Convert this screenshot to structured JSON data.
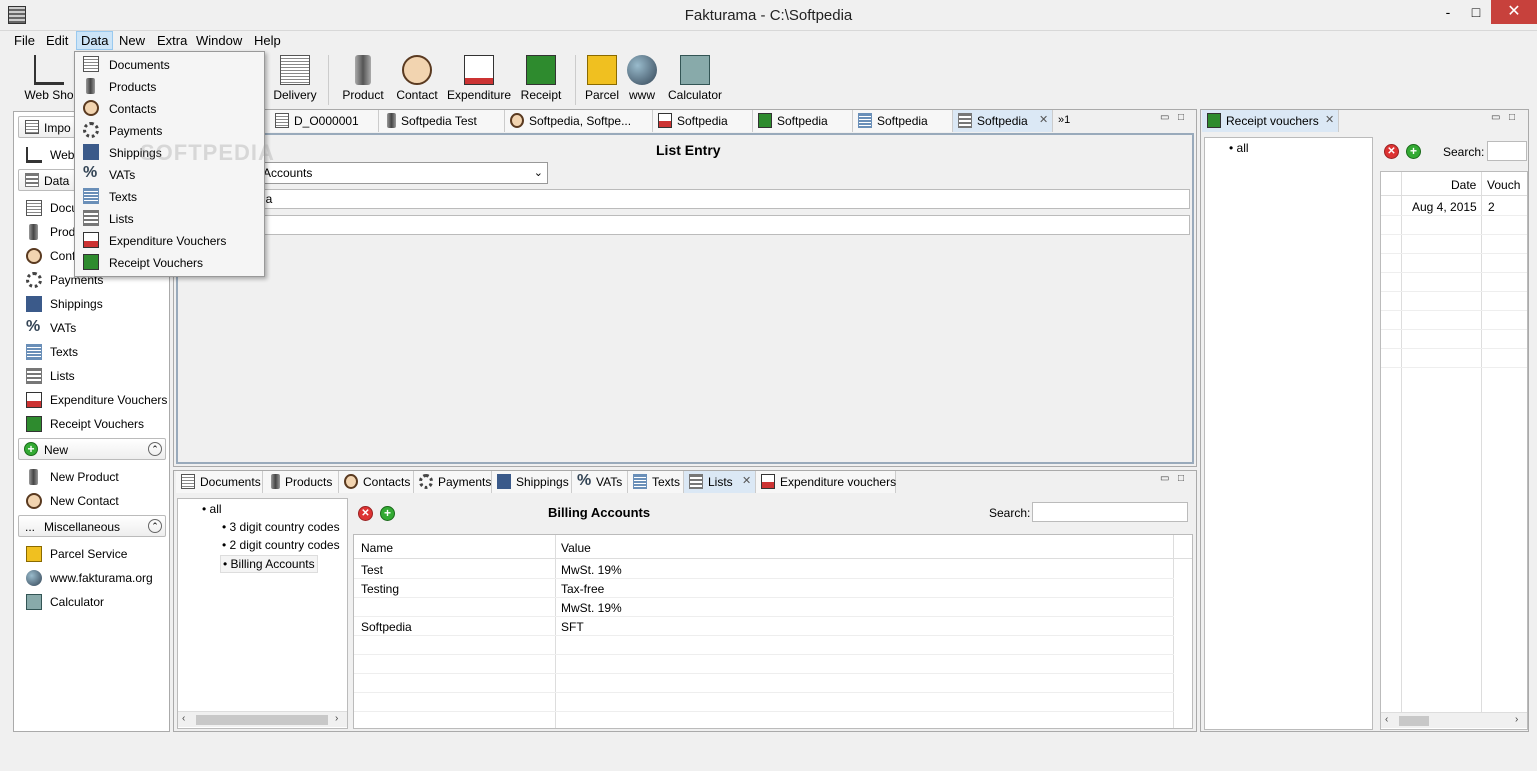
{
  "window": {
    "title": "Fakturama - C:\\Softpedia",
    "minimize": "-",
    "maximize": "□",
    "close": "✕"
  },
  "menubar": {
    "items": [
      "File",
      "Edit",
      "Data",
      "New",
      "Extra",
      "Window",
      "Help"
    ]
  },
  "toolbar": {
    "buttons": [
      "Web Sho",
      "Delivery",
      "Product",
      "Contact",
      "Expenditure",
      "Receipt",
      "Parcel",
      "www",
      "Calculator"
    ]
  },
  "data_menu": {
    "items": [
      "Documents",
      "Products",
      "Contacts",
      "Payments",
      "Shippings",
      "VATs",
      "Texts",
      "Lists",
      "Expenditure Vouchers",
      "Receipt Vouchers"
    ]
  },
  "watermark": "SOFTPEDIA",
  "sidebar": {
    "import_header": "Impo",
    "web_item": "Web",
    "data_header": "Data",
    "data_items": [
      "Docu",
      "Prod",
      "Conf",
      "Payments",
      "Shippings",
      "VATs",
      "Texts",
      "Lists",
      "Expenditure Vouchers",
      "Receipt Vouchers"
    ],
    "new_header": "New",
    "new_items": [
      "New Product",
      "New Contact"
    ],
    "misc_header": "Miscellaneous",
    "misc_items": [
      "Parcel Service",
      "www.fakturama.org",
      "Calculator"
    ]
  },
  "editor": {
    "tabs": [
      "D_O000001",
      "Softpedia Test",
      "Softpedia, Softpe...",
      "Softpedia",
      "Softpedia",
      "Softpedia",
      "Softpedia"
    ],
    "overflow": "»1",
    "heading": "List Entry",
    "category_value": "Accounts",
    "name_value": "ia",
    "value_value": ""
  },
  "lists_view": {
    "tabs": [
      "Documents",
      "Products",
      "Contacts",
      "Payments",
      "Shippings",
      "VATs",
      "Texts",
      "Lists",
      "Expenditure vouchers"
    ],
    "tree": [
      "all",
      "3 digit country codes",
      "2 digit country codes",
      "Billing Accounts"
    ],
    "heading": "Billing Accounts",
    "search_label": "Search:",
    "columns": [
      "Name",
      "Value"
    ],
    "rows": [
      [
        "Test",
        "MwSt. 19%"
      ],
      [
        "Testing",
        "Tax-free"
      ],
      [
        "",
        "MwSt. 19%"
      ],
      [
        "Softpedia",
        "SFT"
      ]
    ]
  },
  "receipt_view": {
    "tab": "Receipt vouchers",
    "tree": [
      "all"
    ],
    "search_label": "Search:",
    "columns": [
      "Date",
      "Vouch"
    ],
    "rows": [
      [
        "Aug 4, 2015",
        "2"
      ]
    ]
  },
  "colors": {
    "accent": "#cce4f7",
    "close": "#c7413c",
    "active_tab": "#dbe8f5"
  }
}
